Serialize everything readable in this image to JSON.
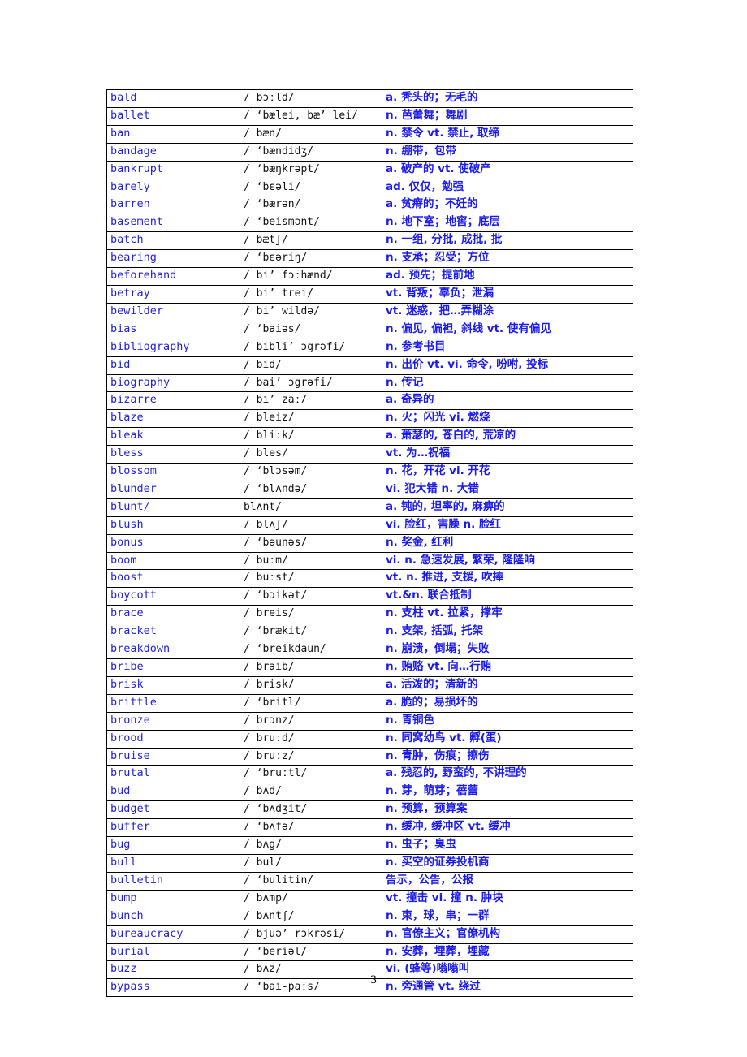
{
  "document": {
    "page_number": "3",
    "colors": {
      "word_text": "#2222dd",
      "definition_text": "#1a1aee",
      "phonetic_text": "#111111",
      "border": "#000000",
      "background": "#ffffff"
    }
  },
  "table": {
    "columns": [
      "word",
      "phonetic",
      "definition"
    ],
    "rows": [
      {
        "word": "bald",
        "phonetic": "/ bɔːld/",
        "definition": "a. 秃头的；无毛的"
      },
      {
        "word": "ballet",
        "phonetic": "/ ‘bælei, bæ’ lei/",
        "definition": "n. 芭蕾舞；舞剧"
      },
      {
        "word": "ban",
        "phonetic": "/ bæn/",
        "definition": "n. 禁令 vt. 禁止, 取缔"
      },
      {
        "word": "bandage",
        "phonetic": "/  ‘bændidʒ/",
        "definition": "n. 绷带，包带"
      },
      {
        "word": "bankrupt",
        "phonetic": "/  ‘bæŋkrəpt/",
        "definition": "a. 破产的 vt. 使破产"
      },
      {
        "word": "barely",
        "phonetic": "/  ‘bɛəli/",
        "definition": "ad. 仅仅，勉强"
      },
      {
        "word": "barren",
        "phonetic": "/  ‘bærən/",
        "definition": "a. 贫瘠的；不妊的"
      },
      {
        "word": "basement",
        "phonetic": "/  ‘beismənt/",
        "definition": "n. 地下室；地窖；底层"
      },
      {
        "word": "batch",
        "phonetic": "/ bætʃ/",
        "definition": "n. 一组, 分批, 成批, 批"
      },
      {
        "word": "bearing",
        "phonetic": "/  ‘bɛəriŋ/",
        "definition": "n. 支承；忍受；方位"
      },
      {
        "word": "beforehand",
        "phonetic": "/ bi’ fɔːhænd/",
        "definition": "ad. 预先；提前地"
      },
      {
        "word": "betray",
        "phonetic": "/ bi’ trei/",
        "definition": "vt. 背叛；辜负；泄漏"
      },
      {
        "word": "bewilder",
        "phonetic": "/ bi’ wildə/",
        "definition": "vt. 迷惑，把…弄糊涂"
      },
      {
        "word": "bias",
        "phonetic": "/  ‘baiəs/",
        "definition": "n. 偏见, 偏袒, 斜线 vt. 使有偏见"
      },
      {
        "word": "bibliography",
        "phonetic": "/ bibli’ ɔgrəfi/",
        "definition": "n. 参考书目"
      },
      {
        "word": "bid",
        "phonetic": "/ bid/",
        "definition": "n. 出价 vt. vi. 命令, 吩咐, 投标"
      },
      {
        "word": "biography",
        "phonetic": "/ bai’ ɔgrəfi/",
        "definition": "n. 传记"
      },
      {
        "word": "bizarre",
        "phonetic": "/ bi’ zaː/",
        "definition": "a. 奇异的"
      },
      {
        "word": "blaze",
        "phonetic": "/ bleiz/",
        "definition": "n. 火；闪光 vi. 燃烧"
      },
      {
        "word": "bleak",
        "phonetic": "/ bliːk/",
        "definition": "a. 萧瑟的, 苍白的, 荒凉的"
      },
      {
        "word": "bless",
        "phonetic": "/ bles/",
        "definition": "vt. 为…祝福"
      },
      {
        "word": "blossom",
        "phonetic": "/  ‘blɔsəm/",
        "definition": "n. 花，开花 vi. 开花"
      },
      {
        "word": "blunder",
        "phonetic": "/  ‘blʌndə/",
        "definition": "vi. 犯大错 n. 大错"
      },
      {
        "word": "blunt/",
        "phonetic": "blʌnt/",
        "definition": "a. 钝的, 坦率的, 麻痹的"
      },
      {
        "word": "blush",
        "phonetic": "/ blʌʃ/",
        "definition": "vi. 脸红，害臊 n. 脸红"
      },
      {
        "word": "bonus",
        "phonetic": "/  ‘bəunəs/",
        "definition": "n. 奖金, 红利"
      },
      {
        "word": "boom",
        "phonetic": "/ buːm/",
        "definition": "vi. n. 急速发展, 繁荣, 隆隆响"
      },
      {
        "word": "boost",
        "phonetic": "/ buːst/",
        "definition": "vt. n. 推进, 支援, 吹捧"
      },
      {
        "word": "boycott",
        "phonetic": "/  ‘bɔikət/",
        "definition": "vt.&n. 联合抵制"
      },
      {
        "word": "brace",
        "phonetic": "/ breis/",
        "definition": "n. 支柱 vt. 拉紧，撑牢"
      },
      {
        "word": "bracket",
        "phonetic": "/  ‘brækit/",
        "definition": "n. 支架, 括弧, 托架"
      },
      {
        "word": "breakdown",
        "phonetic": "/  ‘breikdaun/",
        "definition": "n. 崩溃，倒塌；失败"
      },
      {
        "word": "bribe",
        "phonetic": "/ braib/",
        "definition": "n. 贿赂 vt. 向…行贿"
      },
      {
        "word": "brisk",
        "phonetic": "/ brisk/",
        "definition": "a. 活泼的；清新的"
      },
      {
        "word": "brittle",
        "phonetic": "/  ‘britl/",
        "definition": "a. 脆的；易损坏的"
      },
      {
        "word": "bronze",
        "phonetic": "/ brɔnz/",
        "definition": "n. 青铜色"
      },
      {
        "word": "brood",
        "phonetic": "/ bruːd/",
        "definition": "n. 同窝幼鸟 vt. 孵(蛋)"
      },
      {
        "word": "bruise",
        "phonetic": "/ bruːz/",
        "definition": "n. 青肿，伤痕；擦伤"
      },
      {
        "word": "brutal",
        "phonetic": "/  ‘bruːtl/",
        "definition": "a. 残忍的, 野蛮的, 不讲理的"
      },
      {
        "word": "bud",
        "phonetic": "/ bʌd/",
        "definition": "n. 芽，萌芽；蓓蕾"
      },
      {
        "word": "budget",
        "phonetic": "/  ‘bʌdʒit/",
        "definition": "n. 预算，预算案"
      },
      {
        "word": "buffer",
        "phonetic": "/  ‘bʌfə/",
        "definition": "n. 缓冲, 缓冲区 vt. 缓冲"
      },
      {
        "word": "bug",
        "phonetic": "/ bʌg/",
        "definition": "n. 虫子；臭虫"
      },
      {
        "word": "bull",
        "phonetic": "/ bul/",
        "definition": "n. 买空的证券投机商"
      },
      {
        "word": "bulletin",
        "phonetic": "/  ‘bulitin/",
        "definition": "告示，公告，公报"
      },
      {
        "word": "bump",
        "phonetic": "/ bʌmp/",
        "definition": "vt. 撞击 vi. 撞 n. 肿块"
      },
      {
        "word": "bunch",
        "phonetic": "/ bʌntʃ/",
        "definition": "n. 束，球，串；一群"
      },
      {
        "word": "bureaucracy",
        "phonetic": "/ bjuə’ rɔkrəsi/",
        "definition": "n. 官僚主义；官僚机构"
      },
      {
        "word": "burial",
        "phonetic": "/  ‘beriəl/",
        "definition": "n. 安葬，埋葬，埋藏"
      },
      {
        "word": "buzz",
        "phonetic": "/ bʌz/",
        "definition": "vi. (蜂等)嗡嗡叫"
      },
      {
        "word": "bypass",
        "phonetic": "/  ‘bai-paːs/",
        "definition": "n. 旁通管 vt. 绕过"
      }
    ]
  }
}
